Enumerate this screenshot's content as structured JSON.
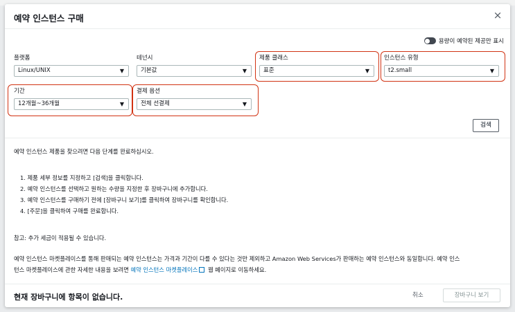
{
  "modal": {
    "title": "예약 인스턴스 구매",
    "close": "×",
    "toggle_label": "용량이 예약된 제공만 표시"
  },
  "filters": {
    "platform": {
      "label": "플랫폼",
      "value": "Linux/UNIX"
    },
    "tenancy": {
      "label": "테넌시",
      "value": "기본값"
    },
    "product_class": {
      "label": "제품 클래스",
      "value": "표준"
    },
    "instance_type": {
      "label": "인스턴스 유형",
      "value": "t2.small"
    },
    "duration": {
      "label": "기간",
      "value": "12개월~36개월"
    },
    "payment_option": {
      "label": "결제 옵션",
      "value": "전체 선결제"
    }
  },
  "search_button": "검색",
  "caret": "▼",
  "instructions": {
    "intro": "예약 인스턴스 제품을 찾으려면 다음 단계를 완료하십시오.",
    "step1": "1. 제품 세부 정보를 지정하고 [검색]을 클릭합니다.",
    "step2": "2. 예약 인스턴스를 선택하고 원하는 수량을 지정한 후 장바구니에 추가합니다.",
    "step3": "3. 예약 인스턴스를 구매하기 전에 [장바구니 보기]를 클릭하여 장바구니를 확인합니다.",
    "step4": "4. [주문]을 클릭하여 구매를 완료합니다.",
    "note": "참고: 추가 세금이 적용될 수 있습니다.",
    "marketplace_line1": "예약 인스턴스 마켓플레이스를 통해 판매되는 예약 인스턴스는 가격과 기간이 다를 수 있다는 것만 제외하고 Amazon Web Services가 판매하는 예약 인스턴스와 동일합니다. 예약 인스",
    "marketplace_line2_prefix": "턴스 마켓플레이스에 관한 자세한 내용을 보려면",
    "marketplace_link": "예약 인스턴스 마켓플레이스",
    "marketplace_line2_suffix": "웹 페이지로 이동하세요."
  },
  "footer": {
    "empty_cart": "현재 장바구니에 항목이 없습니다.",
    "cancel": "취소",
    "view_cart": "장바구니 보기"
  },
  "colors": {
    "highlight": "#d13212",
    "link": "#0073bb"
  }
}
